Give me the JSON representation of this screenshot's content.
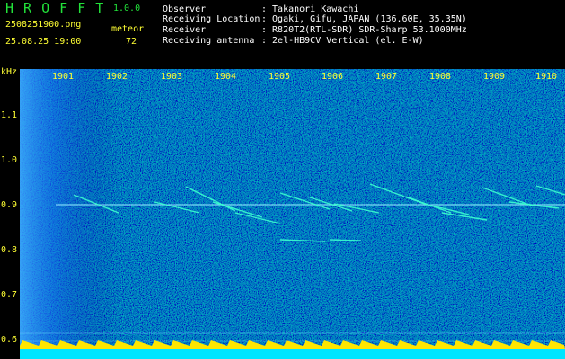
{
  "app": {
    "name": "H R O F F T",
    "version": "1.0.0"
  },
  "capture": {
    "filename": "2508251900.png",
    "datetime": "25.08.25 19:00"
  },
  "meteor": {
    "label": "meteor",
    "count": "72"
  },
  "info": {
    "rows": [
      {
        "label": "Observer",
        "value": ": Takanori Kawachi"
      },
      {
        "label": "Receiving Location",
        "value": ": Ogaki, Gifu, JAPAN (136.60E, 35.35N)"
      },
      {
        "label": "Receiver",
        "value": ": R820T2(RTL-SDR) SDR-Sharp 53.1000MHz"
      },
      {
        "label": "Receiving antenna",
        "value": ": 2el-HB9CV Vertical (el. E-W)"
      }
    ]
  },
  "axis": {
    "y_unit": "kHz",
    "y_ticks": [
      "1.1",
      "1.0",
      "0.9",
      "0.8",
      "0.7",
      "0.6"
    ],
    "x_ticks": [
      "1901",
      "1902",
      "1903",
      "1904",
      "1905",
      "1906",
      "1907",
      "1908",
      "1909",
      "1910"
    ]
  },
  "colors": {
    "background": "#000000",
    "title": "#22e23a",
    "accent": "#ffff33",
    "spectrum_bg": "#001a9a",
    "signal": "#00ffee"
  }
}
